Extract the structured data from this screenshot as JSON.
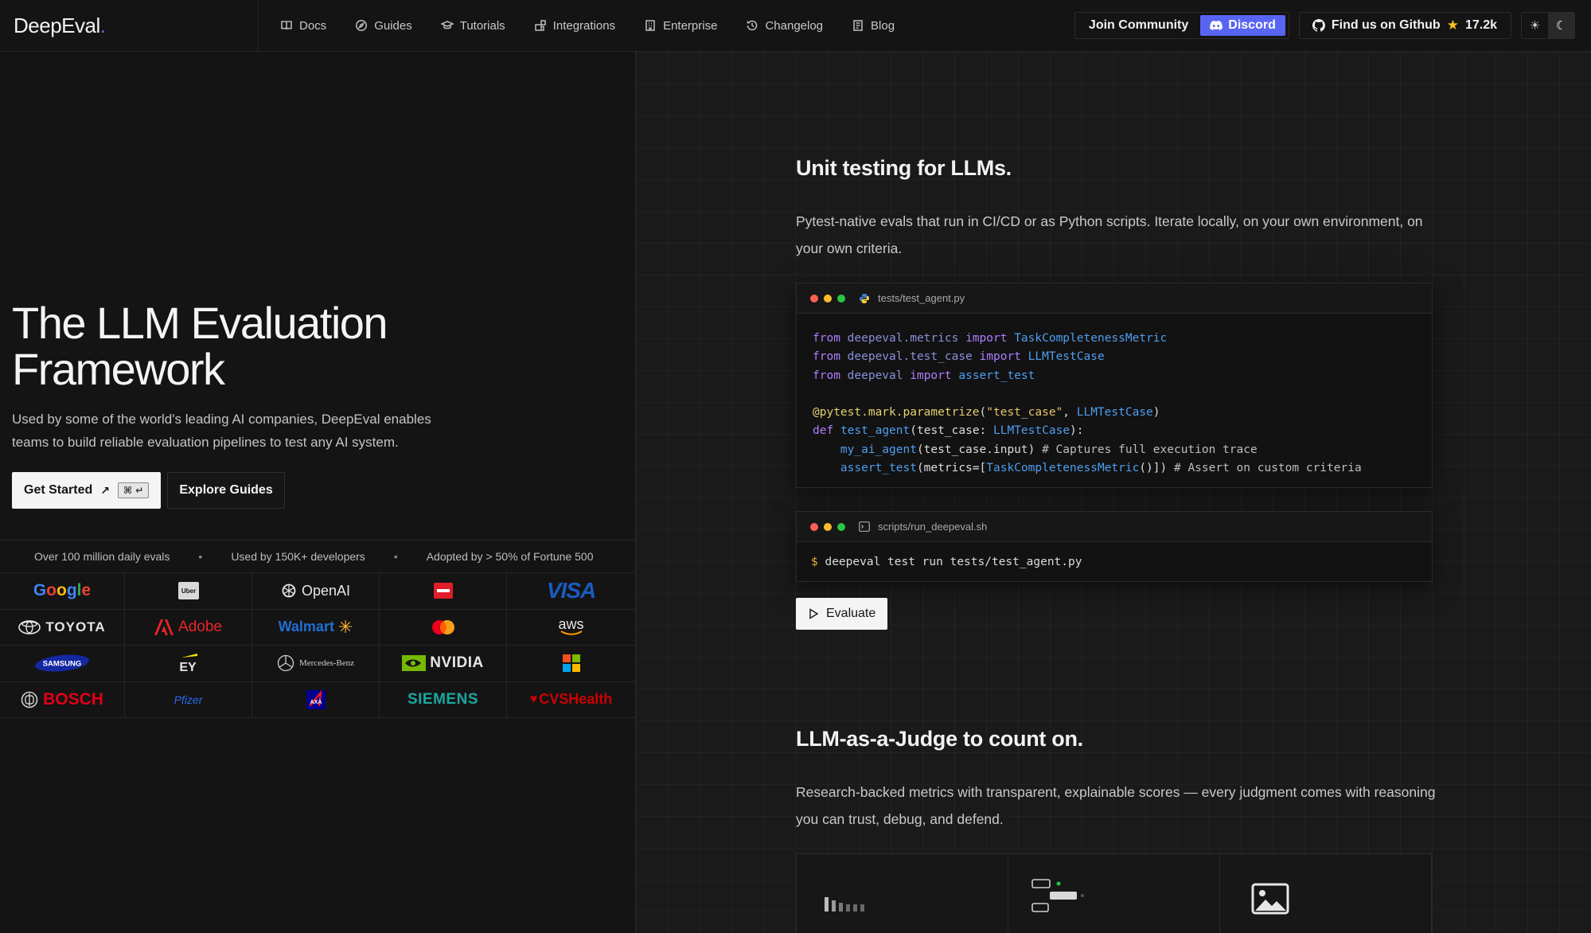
{
  "nav": {
    "brand": "DeepEval",
    "brand_dot": ".",
    "links": [
      {
        "label": "Docs",
        "icon": "book-icon"
      },
      {
        "label": "Guides",
        "icon": "compass-icon"
      },
      {
        "label": "Tutorials",
        "icon": "graduation-cap-icon"
      },
      {
        "label": "Integrations",
        "icon": "puzzle-icon"
      },
      {
        "label": "Enterprise",
        "icon": "building-icon"
      },
      {
        "label": "Changelog",
        "icon": "history-icon"
      },
      {
        "label": "Blog",
        "icon": "newspaper-icon"
      }
    ],
    "community_label": "Join Community",
    "discord_label": "Discord",
    "github_label": "Find us on Github",
    "github_stars": "17.2k"
  },
  "hero": {
    "title_line1": "The LLM Evaluation",
    "title_line2": "Framework",
    "subtitle": "Used by some of the world's leading AI companies, DeepEval enables teams to build reliable evaluation pipelines to test any AI system.",
    "primary_label": "Get Started",
    "primary_arrow": "↗",
    "primary_shortcut": "⌘ ↵",
    "secondary_label": "Explore Guides"
  },
  "stats": [
    "Over 100 million daily evals",
    "Used by 150K+ developers",
    "Adopted by > 50% of Fortune 500"
  ],
  "stats_sep": "•",
  "logos": [
    "Google",
    "Uber",
    "OpenAI",
    "Accenture",
    "VISA",
    "TOYOTA",
    "Adobe",
    "Walmart",
    "Mastercard",
    "aws",
    "SAMSUNG",
    "EY",
    "Mercedes-Benz",
    "NVIDIA",
    "Microsoft",
    "BOSCH",
    "Pfizer",
    "AXA",
    "SIEMENS",
    "CVSHealth"
  ],
  "colors": {
    "discord": "#5865f2",
    "star": "#f5c518",
    "accent": "#7c5cff",
    "traffic_red": "#ff5f57",
    "traffic_yellow": "#febc2e",
    "traffic_green": "#28c840"
  },
  "section1": {
    "title": "Unit testing for LLMs.",
    "desc": "Pytest-native evals that run in CI/CD or as Python scripts. Iterate locally, on your own environment, on your own criteria.",
    "file1": "tests/test_agent.py",
    "file2": "scripts/run_deepeval.sh",
    "shell_prompt": "$",
    "shell_cmd": " deepeval test run tests/test_agent.py",
    "evaluate_label": "Evaluate"
  },
  "section2": {
    "title": "LLM-as-a-Judge to count on.",
    "desc": "Research-backed metrics with transparent, explainable scores — every judgment comes with reasoning you can trust, debug, and defend."
  }
}
